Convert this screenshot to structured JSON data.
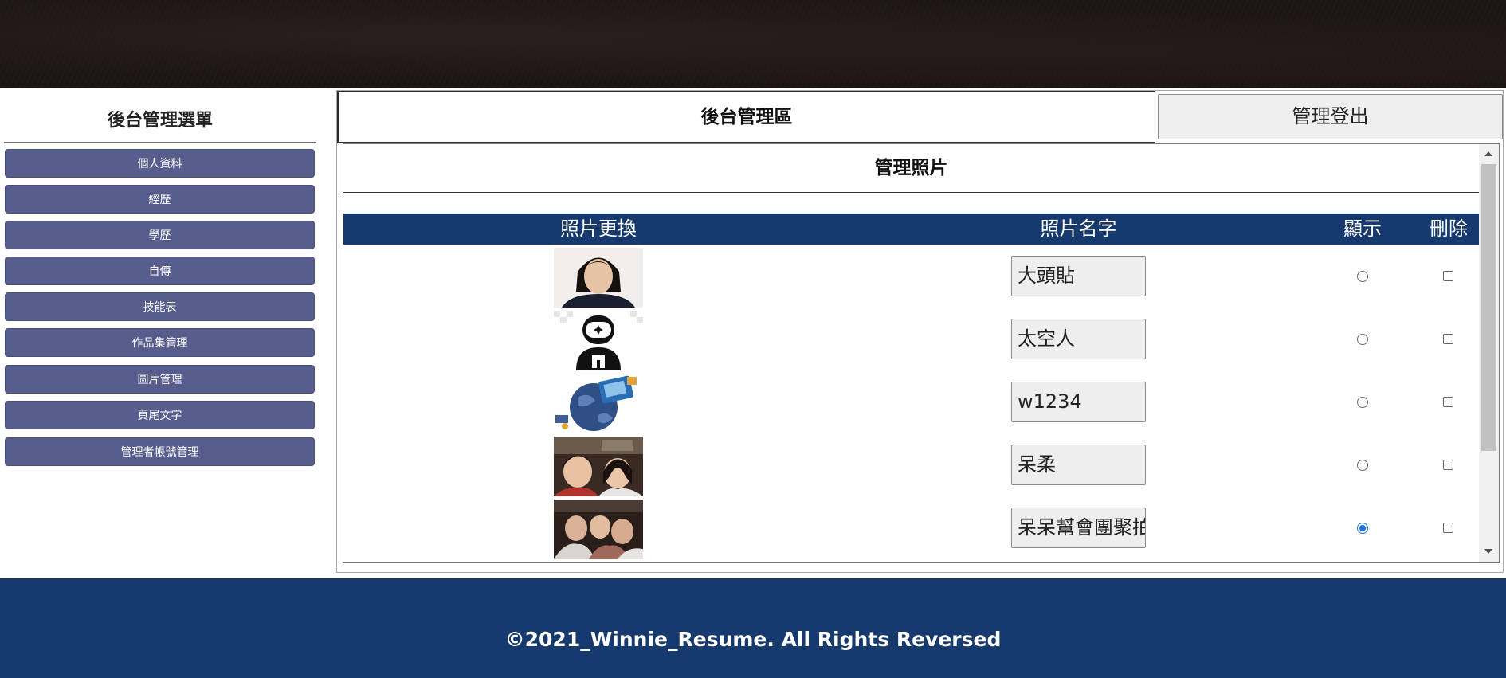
{
  "sidebar": {
    "title": "後台管理選單",
    "items": [
      {
        "label": "個人資料"
      },
      {
        "label": "經歷"
      },
      {
        "label": "學歷"
      },
      {
        "label": "自傳"
      },
      {
        "label": "技能表"
      },
      {
        "label": "作品集管理"
      },
      {
        "label": "圖片管理"
      },
      {
        "label": "頁尾文字"
      },
      {
        "label": "管理者帳號管理"
      }
    ]
  },
  "header": {
    "title": "後台管理區",
    "logout_label": "管理登出"
  },
  "section": {
    "title": "管理照片"
  },
  "table": {
    "columns": [
      "照片更換",
      "照片名字",
      "顯示",
      "刪除"
    ],
    "rows": [
      {
        "thumb_icon": "portrait-photo",
        "name": "大頭貼",
        "display": false,
        "delete": false
      },
      {
        "thumb_icon": "astronaut-icon",
        "name": "太空人",
        "display": false,
        "delete": false
      },
      {
        "thumb_icon": "globe-satellite-illustration",
        "name": "w1234",
        "display": false,
        "delete": false
      },
      {
        "thumb_icon": "selfie-photo",
        "name": "呆柔",
        "display": false,
        "delete": false
      },
      {
        "thumb_icon": "group-photo",
        "name": "呆呆幫會團聚拍",
        "display": true,
        "delete": false
      }
    ]
  },
  "footer": {
    "text": "©2021_Winnie_Resume. All Rights Reversed"
  },
  "colors": {
    "menu_button": "#575d8d",
    "navy": "#173a6e",
    "radio_checked": "#1a73e8"
  }
}
